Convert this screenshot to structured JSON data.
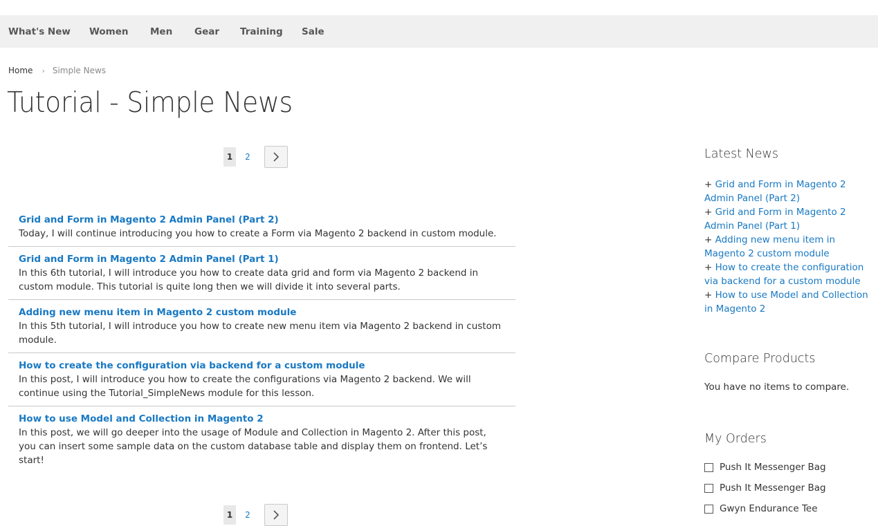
{
  "nav": {
    "items": [
      {
        "label": "What's New"
      },
      {
        "label": "Women"
      },
      {
        "label": "Men"
      },
      {
        "label": "Gear"
      },
      {
        "label": "Training"
      },
      {
        "label": "Sale"
      }
    ]
  },
  "breadcrumb": {
    "home": "Home",
    "separator": "›",
    "current": "Simple News"
  },
  "page_title": "Tutorial - Simple News",
  "pager": {
    "current_page": "1",
    "other_page": "2"
  },
  "news": [
    {
      "title": "Grid and Form in Magento 2 Admin Panel (Part 2)",
      "description": "Today, I will continue introducing you how to create a Form via Magento 2 backend in custom module."
    },
    {
      "title": "Grid and Form in Magento 2 Admin Panel (Part 1)",
      "description": "In this 6th tutorial, I will introduce you how to create data grid and form via Magento 2 backend in custom module. This tutorial is quite long then we will divide it into several parts."
    },
    {
      "title": "Adding new menu item in Magento 2 custom module",
      "description": "In this 5th tutorial, I will introduce you how to create new menu item via Magento 2 backend in custom module."
    },
    {
      "title": "How to create the configuration via backend for a custom module",
      "description": "In this post, I will introduce you how to create the configurations via Magento 2 backend. We will continue using the Tutorial_SimpleNews module for this lesson."
    },
    {
      "title": "How to use Model and Collection in Magento 2",
      "description": "In this post, we will go deeper into the usage of Module and Collection in Magento 2. After this post, you can insert some sample data on the custom database table and display them on frontend. Let’s start!"
    }
  ],
  "sidebar": {
    "latest_news": {
      "title": "Latest News",
      "prefix": "+ ",
      "items": [
        "Grid and Form in Magento 2 Admin Panel (Part 2)",
        "Grid and Form in Magento 2 Admin Panel (Part 1)",
        "Adding new menu item in Magento 2 custom module",
        "How to create the configuration via backend for a custom module",
        "How to use Model and Collection in Magento 2"
      ]
    },
    "compare": {
      "title": "Compare Products",
      "empty_text": "You have no items to compare."
    },
    "orders": {
      "title": "My Orders",
      "items": [
        {
          "label": "Push It Messenger Bag",
          "checked": false
        },
        {
          "label": "Push It Messenger Bag",
          "checked": false
        },
        {
          "label": "Gwyn Endurance Tee",
          "checked": false
        }
      ]
    }
  },
  "colors": {
    "link": "#1979c3",
    "nav_bg": "#f0f0f0",
    "text": "#333333",
    "divider": "#c9c9c9"
  }
}
